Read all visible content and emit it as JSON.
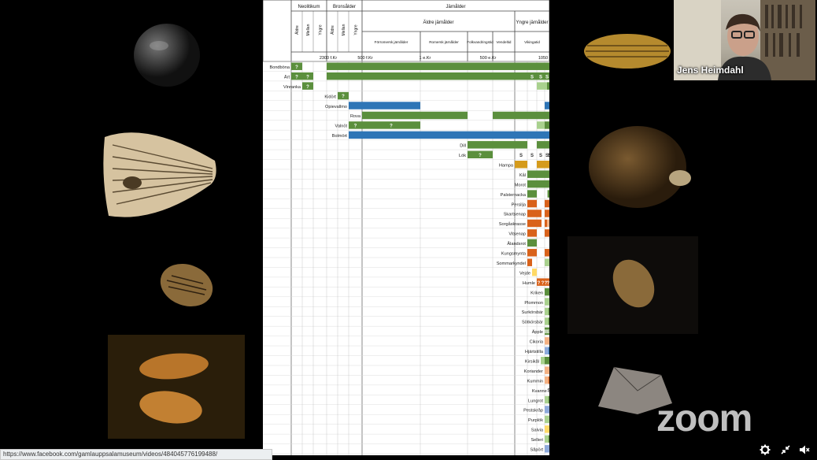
{
  "speaker": {
    "name": "Jens Heimdahl"
  },
  "status_url": "https://www.facebook.com/gamlauppsalamuseum/videos/484045776199488/",
  "watermark": "zoom",
  "icons": {
    "settings": "gear-icon",
    "fullscreen": "exit-fullscreen-icon",
    "audio": "speaker-mute-icon"
  },
  "colors": {
    "green": "#5b8f3d",
    "light_green": "#a9d18e",
    "blue": "#2e75b6",
    "light_blue": "#8eaadb",
    "orange": "#d9621b",
    "light_orange": "#f4b183",
    "gold": "#d59b1c",
    "yellow": "#ffd966"
  },
  "chart_data": {
    "type": "table",
    "period_headers": {
      "neolitikum": "Neolitikum",
      "bronsalder": "Bronsålder",
      "jarnalder": "Järnålder",
      "aldre_jarnalder": "Äldre järnålder",
      "yngre_jarnalder": "Yngre järnålder",
      "sub_neo": [
        "Äldre",
        "Mellan",
        "Yngre"
      ],
      "sub_brons": [
        "Äldre",
        "Mellan",
        "Yngre"
      ],
      "sub_jarn": [
        "Förromersk järnålder",
        "Romersk järnålder",
        "Folkvandringstid",
        "Vendeltid",
        "Vikingatid"
      ]
    },
    "time_ticks": [
      "2300 f.Kr",
      "500 f.Kr",
      "1 e.Kr",
      "500 e.Kr",
      "1050"
    ],
    "rows": [
      {
        "label": "Bondböna",
        "segments": [
          {
            "from": 0,
            "to": 1,
            "c": "green",
            "t": "?"
          },
          {
            "from": 3,
            "to": 14,
            "c": "green"
          }
        ]
      },
      {
        "label": "Ärt",
        "segments": [
          {
            "from": 0,
            "to": 1,
            "c": "green",
            "t": "?"
          },
          {
            "from": 1,
            "to": 2,
            "c": "green",
            "t": "?"
          },
          {
            "from": 3,
            "to": 11,
            "c": "green"
          },
          {
            "from": 11,
            "to": 12,
            "c": "green",
            "t": "S"
          },
          {
            "from": 12,
            "to": 13,
            "c": "green",
            "t": "S"
          },
          {
            "from": 13,
            "to": 14,
            "c": "green",
            "t": "S"
          }
        ]
      },
      {
        "label": "Vinranka",
        "segments": [
          {
            "from": 1,
            "to": 2,
            "c": "green",
            "t": "?"
          },
          {
            "from": 12,
            "to": 13.5,
            "c": "light_green"
          },
          {
            "from": 13.5,
            "to": 14,
            "c": "green"
          }
        ]
      },
      {
        "label": "Kidört",
        "segments": [
          {
            "from": 4,
            "to": 5,
            "c": "green",
            "t": "?"
          }
        ]
      },
      {
        "label": "Opievallmo",
        "segments": [
          {
            "from": 5,
            "to": 7,
            "c": "blue"
          },
          {
            "from": 13,
            "to": 14,
            "c": "blue"
          }
        ]
      },
      {
        "label": "Rova",
        "segments": [
          {
            "from": 6,
            "to": 8,
            "c": "green"
          },
          {
            "from": 9,
            "to": 14,
            "c": "green"
          }
        ]
      },
      {
        "label": "Valnöt",
        "segments": [
          {
            "from": 5,
            "to": 6,
            "c": "green",
            "t": "?"
          },
          {
            "from": 6,
            "to": 7,
            "c": "green",
            "t": "?"
          },
          {
            "from": 12,
            "to": 13,
            "c": "light_green"
          },
          {
            "from": 13,
            "to": 14,
            "c": "green"
          }
        ]
      },
      {
        "label": "Bolmört",
        "segments": [
          {
            "from": 5,
            "to": 14,
            "c": "blue"
          }
        ]
      },
      {
        "label": "Dill",
        "segments": [
          {
            "from": 8,
            "to": 9,
            "c": "green"
          },
          {
            "from": 9,
            "to": 11,
            "c": "green"
          },
          {
            "from": 12,
            "to": 14,
            "c": "green"
          }
        ]
      },
      {
        "label": "Lök",
        "segments": [
          {
            "from": 8,
            "to": 9,
            "c": "green",
            "t": "?"
          },
          {
            "from": 10,
            "to": 11,
            "c": "none",
            "t": "S"
          },
          {
            "from": 11,
            "to": 12,
            "c": "none",
            "t": "S"
          },
          {
            "from": 12,
            "to": 13,
            "c": "none",
            "t": "S"
          },
          {
            "from": 13,
            "to": 14,
            "c": "none",
            "t": "S"
          },
          {
            "from": 14,
            "to": 16,
            "c": "green"
          },
          {
            "from": 16,
            "to": 17,
            "c": "none",
            "t": "S"
          },
          {
            "from": 17,
            "to": 18,
            "c": "none",
            "t": "S"
          },
          {
            "from": 18,
            "to": 19,
            "c": "green"
          }
        ]
      },
      {
        "label": "Hampa",
        "segments": [
          {
            "from": 10,
            "to": 11,
            "c": "gold"
          },
          {
            "from": 12,
            "to": 14,
            "c": "gold"
          }
        ]
      },
      {
        "label": "Kål",
        "segments": [
          {
            "from": 11,
            "to": 14,
            "c": "green"
          }
        ]
      },
      {
        "label": "Morot",
        "segments": [
          {
            "from": 11,
            "to": 13,
            "c": "green"
          },
          {
            "from": 13,
            "to": 14,
            "c": "green"
          }
        ]
      },
      {
        "label": "Palsternacka",
        "segments": [
          {
            "from": 11,
            "to": 12,
            "c": "green"
          },
          {
            "from": 13.6,
            "to": 14,
            "c": "green"
          }
        ]
      },
      {
        "label": "Persilja",
        "segments": [
          {
            "from": 11,
            "to": 12,
            "c": "orange"
          },
          {
            "from": 13,
            "to": 14,
            "c": "orange"
          }
        ]
      },
      {
        "label": "Skartsenap",
        "segments": [
          {
            "from": 11,
            "to": 12.6,
            "c": "orange"
          },
          {
            "from": 13,
            "to": 14,
            "c": "orange"
          }
        ]
      },
      {
        "label": "Sorgåskrasse",
        "segments": [
          {
            "from": 11,
            "to": 12.6,
            "c": "orange"
          },
          {
            "from": 13,
            "to": 13.5,
            "c": "orange"
          },
          {
            "from": 13.5,
            "to": 14,
            "c": "light_orange"
          }
        ]
      },
      {
        "label": "Vitsenap",
        "segments": [
          {
            "from": 11,
            "to": 12,
            "c": "orange"
          },
          {
            "from": 13,
            "to": 14,
            "c": "orange"
          }
        ]
      },
      {
        "label": "Ålandsrot",
        "segments": [
          {
            "from": 11,
            "to": 12,
            "c": "green"
          }
        ]
      },
      {
        "label": "Kungsmynta",
        "segments": [
          {
            "from": 11,
            "to": 12,
            "c": "orange"
          },
          {
            "from": 13,
            "to": 14,
            "c": "orange"
          }
        ]
      },
      {
        "label": "Sommarkyndel",
        "segments": [
          {
            "from": 11,
            "to": 11.5,
            "c": "orange"
          },
          {
            "from": 13,
            "to": 14,
            "c": "light_green"
          }
        ]
      },
      {
        "label": "Vejde",
        "segments": [
          {
            "from": 11.5,
            "to": 12,
            "c": "yellow"
          }
        ]
      },
      {
        "label": "Humle",
        "segments": [
          {
            "from": 12,
            "to": 12.5,
            "c": "orange",
            "t": "?"
          },
          {
            "from": 12.5,
            "to": 13,
            "c": "orange",
            "t": "?"
          },
          {
            "from": 13,
            "to": 13.5,
            "c": "orange",
            "t": "?"
          },
          {
            "from": 13.5,
            "to": 14,
            "c": "orange",
            "t": "?"
          }
        ]
      },
      {
        "label": "Kriken",
        "segments": [
          {
            "from": 13,
            "to": 14,
            "c": "green"
          }
        ]
      },
      {
        "label": "Plommon",
        "segments": [
          {
            "from": 13,
            "to": 14,
            "c": "light_green"
          }
        ]
      },
      {
        "label": "Surkörsbär",
        "segments": [
          {
            "from": 13,
            "to": 13.8,
            "c": "light_green"
          },
          {
            "from": 13.8,
            "to": 14,
            "c": "green"
          }
        ]
      },
      {
        "label": "Sötkörsbär",
        "segments": [
          {
            "from": 13,
            "to": 13.8,
            "c": "light_green"
          },
          {
            "from": 13.8,
            "to": 14,
            "c": "green"
          }
        ]
      },
      {
        "label": "Äpple",
        "segments": [
          {
            "from": 13,
            "to": 13.33,
            "c": "green",
            "t": "S"
          },
          {
            "from": 13.33,
            "to": 13.66,
            "c": "green",
            "t": "S"
          },
          {
            "from": 13.66,
            "to": 14,
            "c": "green",
            "t": "S"
          }
        ]
      },
      {
        "label": "Cikoria",
        "segments": [
          {
            "from": 13,
            "to": 14,
            "c": "light_orange"
          }
        ]
      },
      {
        "label": "Hjärtstilla",
        "segments": [
          {
            "from": 13,
            "to": 13.8,
            "c": "light_blue"
          },
          {
            "from": 13.8,
            "to": 14,
            "c": "blue"
          }
        ]
      },
      {
        "label": "Kirsikål",
        "segments": [
          {
            "from": 12.5,
            "to": 13,
            "c": "light_green"
          },
          {
            "from": 13,
            "to": 14,
            "c": "green"
          }
        ]
      },
      {
        "label": "Koriander",
        "segments": [
          {
            "from": 13,
            "to": 14,
            "c": "light_orange"
          }
        ]
      },
      {
        "label": "Kummin",
        "segments": [
          {
            "from": 13,
            "to": 13.8,
            "c": "light_orange"
          },
          {
            "from": 13.8,
            "to": 14,
            "c": "orange"
          }
        ]
      },
      {
        "label": "Kvanne",
        "segments": [
          {
            "from": 13.8,
            "to": 14,
            "c": "none",
            "t": "S"
          }
        ]
      },
      {
        "label": "Lungrot",
        "segments": [
          {
            "from": 13,
            "to": 13.8,
            "c": "light_green"
          },
          {
            "from": 13.8,
            "to": 14,
            "c": "green"
          }
        ]
      },
      {
        "label": "Pestskråp",
        "segments": [
          {
            "from": 13,
            "to": 14,
            "c": "light_blue"
          }
        ]
      },
      {
        "label": "Purplök",
        "segments": [
          {
            "from": 13,
            "to": 14,
            "c": "light_green"
          }
        ]
      },
      {
        "label": "Salvia",
        "segments": [
          {
            "from": 13,
            "to": 14,
            "c": "yellow"
          }
        ]
      },
      {
        "label": "Selleri",
        "segments": [
          {
            "from": 13,
            "to": 13.8,
            "c": "light_green"
          },
          {
            "from": 13.8,
            "to": 14,
            "c": "green"
          }
        ]
      },
      {
        "label": "Såpört",
        "segments": [
          {
            "from": 13,
            "to": 14,
            "c": "light_blue"
          }
        ]
      }
    ]
  }
}
